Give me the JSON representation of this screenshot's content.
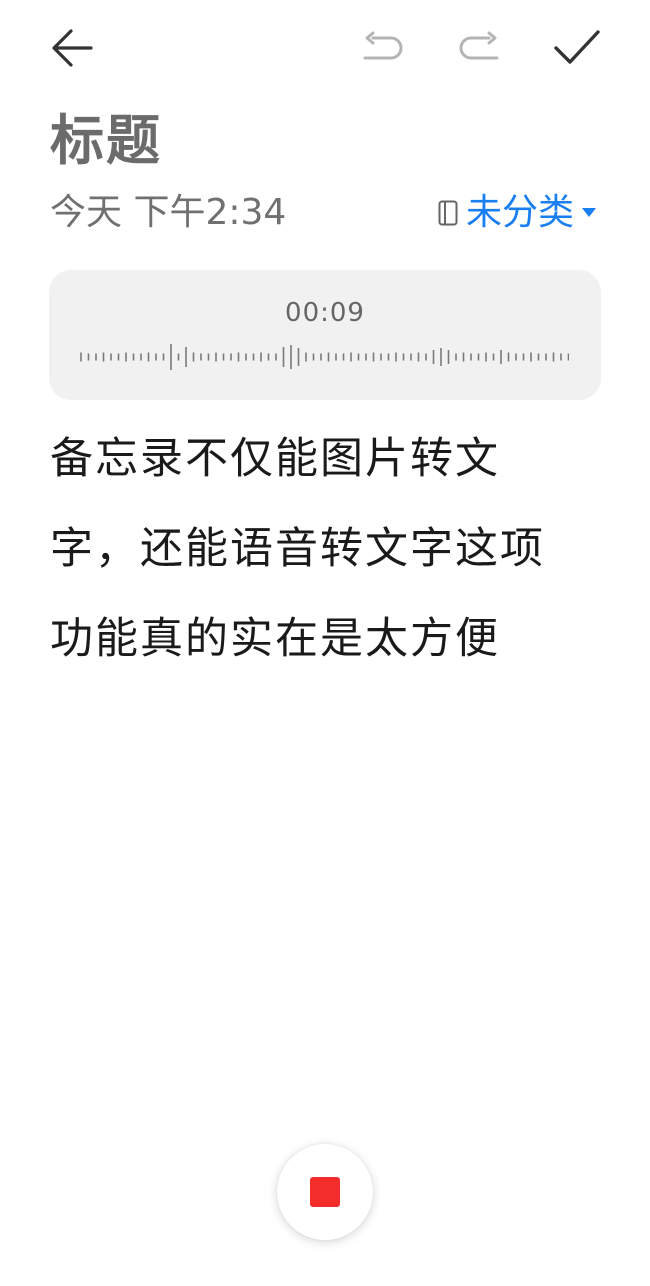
{
  "toolbar": {
    "back_icon": "arrow-left-icon",
    "undo_icon": "undo-icon",
    "redo_icon": "redo-icon",
    "done_icon": "checkmark-icon",
    "undo_enabled": false,
    "redo_enabled": false
  },
  "note": {
    "title": "标题",
    "date": "今天 下午2:34",
    "category_label": "未分类",
    "category_icon": "notebook-icon",
    "category_caret_icon": "caret-down-icon",
    "body": "备忘录不仅能图片转文字，还能语音转文字这项功能真的实在是太方便"
  },
  "recording": {
    "elapsed": "00:09",
    "stop_icon": "stop-icon"
  },
  "colors": {
    "accent": "#1a7ff0",
    "stop": "#f32c2c",
    "card_bg": "#f1f1f1",
    "title_gray": "#6b6b6b",
    "disabled_icon": "#b4b4b4"
  }
}
